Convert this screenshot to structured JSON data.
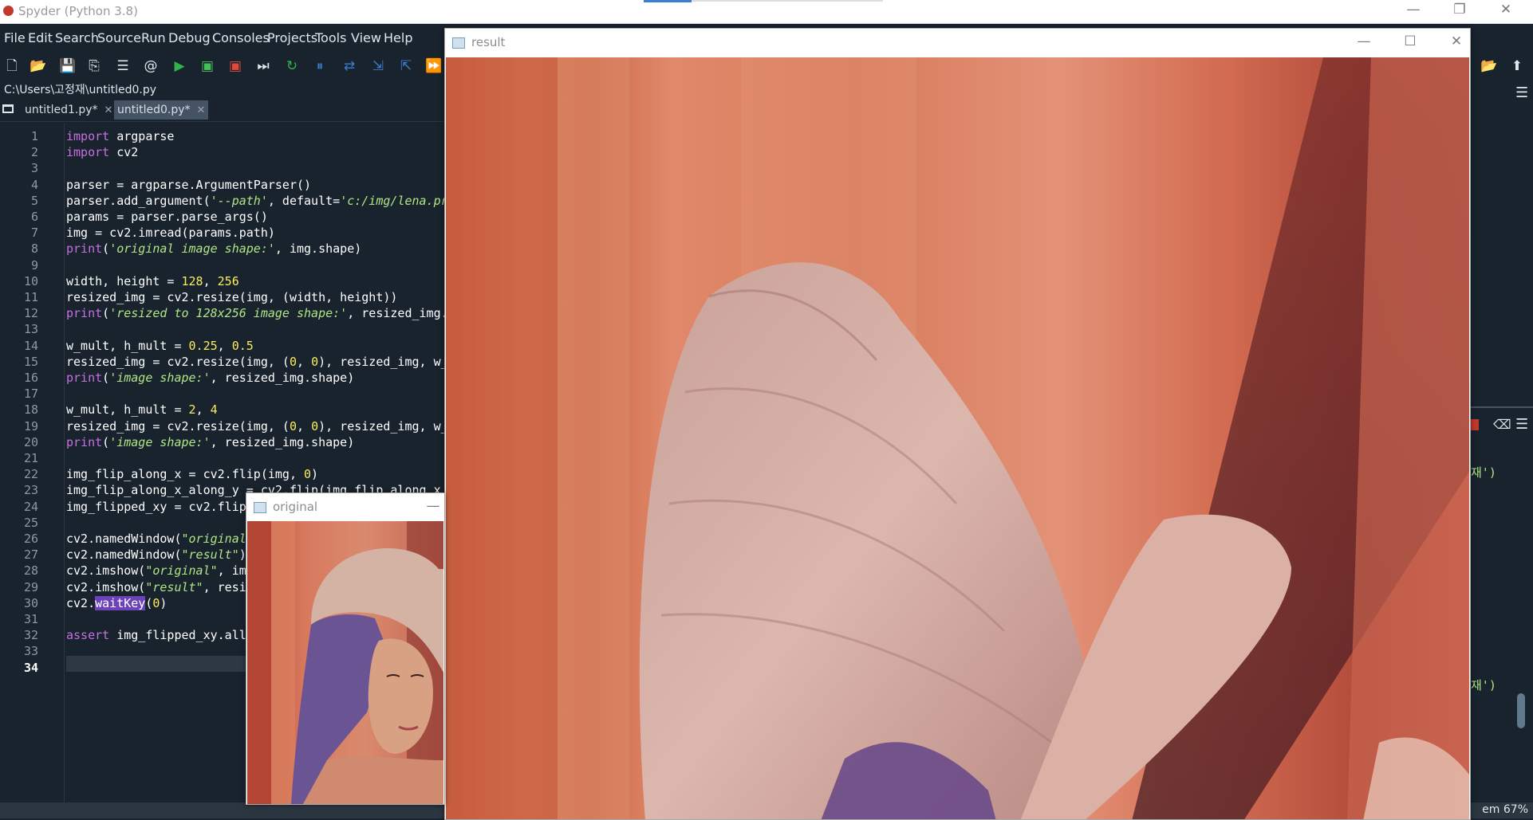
{
  "window": {
    "title": "Spyder (Python 3.8)",
    "minimize": "—",
    "maximize": "❐",
    "close": "✕"
  },
  "menu": [
    "File",
    "Edit",
    "Search",
    "Source",
    "Run",
    "Debug",
    "Consoles",
    "Projects",
    "Tools",
    "View",
    "Help"
  ],
  "toolbar_icons": [
    "new-file-icon",
    "open-file-icon",
    "save-icon",
    "save-all-icon",
    "outline-icon",
    "at-icon",
    "run-icon",
    "run-cell-icon",
    "run-cell-advance-icon",
    "run-selection-icon",
    "re-run-icon",
    "debug-icon",
    "step-icon",
    "step-into-icon",
    "step-return-icon",
    "continue-icon"
  ],
  "path": "C:\\Users\\고정재\\untitled0.py",
  "editor_tabs": [
    {
      "label": "untitled1.py*",
      "active": false
    },
    {
      "label": "untitled0.py*",
      "active": true
    }
  ],
  "code": [
    "import argparse",
    "import cv2",
    "",
    "parser = argparse.ArgumentParser()",
    "parser.add_argument('--path', default='c:/img/lena.pr",
    "params = parser.parse_args()",
    "img = cv2.imread(params.path)",
    "print('original image shape:', img.shape)",
    "",
    "width, height = 128, 256",
    "resized_img = cv2.resize(img, (width, height))",
    "print('resized to 128x256 image shape:', resized_img.",
    "",
    "w_mult, h_mult = 0.25, 0.5",
    "resized_img = cv2.resize(img, (0, 0), resized_img, w_",
    "print('image shape:', resized_img.shape)",
    "",
    "w_mult, h_mult = 2, 4",
    "resized_img = cv2.resize(img, (0, 0), resized_img, w_",
    "print('image shape:', resized_img.shape)",
    "",
    "img_flip_along_x = cv2.flip(img, 0)",
    "img_flip_along_x_along_y = cv2.flip(img_flip_along_x",
    "img_flipped_xy = cv2.flip",
    "",
    "cv2.namedWindow(\"original",
    "cv2.namedWindow(\"result\")",
    "cv2.imshow(\"original\", im",
    "cv2.imshow(\"result\", resi",
    "cv2.waitKey(0)",
    "",
    "assert img_flipped_xy.all",
    "",
    ""
  ],
  "current_line": 34,
  "right_pane": {
    "console_snippet_1": "재')",
    "console_snippet_2": "재')"
  },
  "status": {
    "memory": "em 67%"
  },
  "cv_windows": {
    "result": {
      "title": "result"
    },
    "original": {
      "title": "original"
    }
  }
}
